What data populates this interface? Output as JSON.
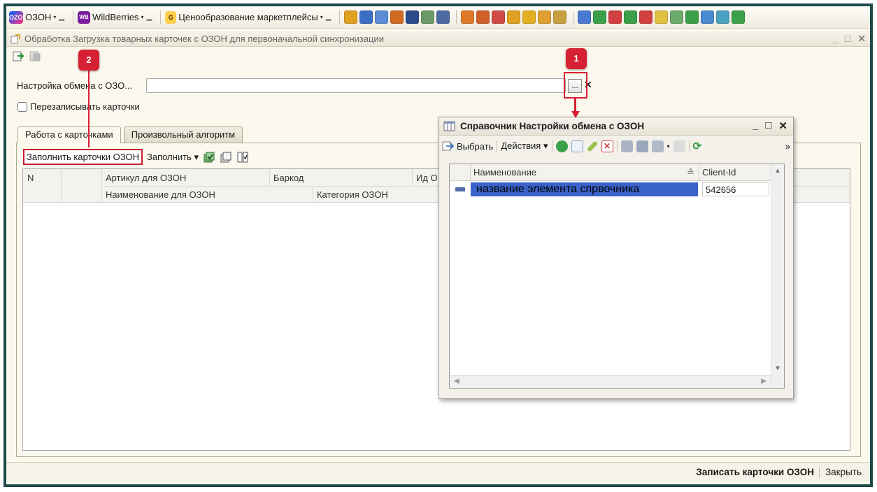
{
  "topbar": {
    "ozon_logo": "OZON",
    "ozon_label": "ОЗОН",
    "wb_logo": "WB",
    "wb_label": "WildBerries",
    "pricing_label": "Ценообразование маркетплейсы"
  },
  "window": {
    "title": "Обработка  Загрузка товарных карточек с ОЗОН для первоначальной синхронизации",
    "minimize": "_",
    "maximize": "□",
    "close": "✕"
  },
  "form": {
    "exchange_label": "Настройка обмена с ОЗО...",
    "exchange_value": "",
    "dots": "...",
    "clear": "✕",
    "overwrite_label": "Перезаписывать карточки"
  },
  "tabs": [
    {
      "label": "Работа с карточками"
    },
    {
      "label": "Произвольный алгоритм"
    }
  ],
  "cmdbar": {
    "fill_ozon": "Заполнить карточки ОЗОН",
    "fill": "Заполнить",
    "caret": "▾"
  },
  "grid": {
    "col_n": "N",
    "col_article": "Артикул для ОЗОН",
    "col_barcode": "Баркод",
    "col_id": "Ид О",
    "col_name": "Наименование для ОЗОН",
    "col_category": "Категория ОЗОН"
  },
  "dialog": {
    "title": "Справочник Настройки обмена с ОЗОН",
    "minimize": "_",
    "maximize": "□",
    "close": "✕",
    "select_label": "Выбрать",
    "actions_label": "Действия",
    "more": "»",
    "col_name": "Наименование",
    "col_client": "Client-Id",
    "sort_mark": "≙",
    "row_name": "название элемента спрвочника",
    "row_client": "542656"
  },
  "callouts": {
    "one": "1",
    "two": "2"
  },
  "statusbar": {
    "save": "Записать карточки ОЗОН",
    "close": "Закрыть"
  },
  "colors": {
    "frame": "#1f4a49",
    "accent_red": "#d62033",
    "selection": "#3a62c8"
  }
}
